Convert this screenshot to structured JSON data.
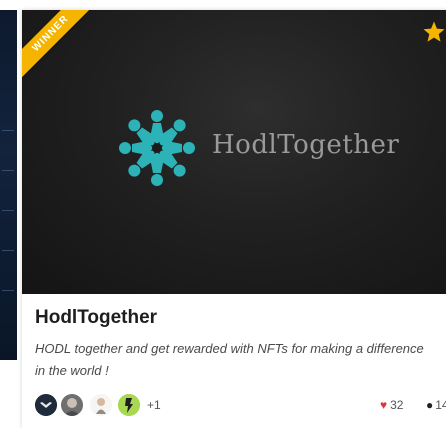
{
  "badge": {
    "ribbon_text": "WINNER",
    "ribbon_color": "#f4b400",
    "star_icon": "star-icon",
    "star_color": "#f4b400"
  },
  "banner": {
    "brand_text": "HodlTogether",
    "logo_icon": "hodltogether-logo-icon",
    "logo_color": "#2cb3b8"
  },
  "project": {
    "title": "HodlTogether",
    "description": "HODL together and get rewarded with NFTs for making a difference in the world !"
  },
  "team": {
    "avatars": [
      "avatar-1",
      "avatar-2",
      "avatar-3",
      "avatar-4"
    ],
    "more_label": "+1"
  },
  "stats": {
    "likes": "32",
    "likes_icon": "heart-icon",
    "comments": "14",
    "comments_icon": "comment-icon",
    "heart_color": "#d9383a"
  }
}
